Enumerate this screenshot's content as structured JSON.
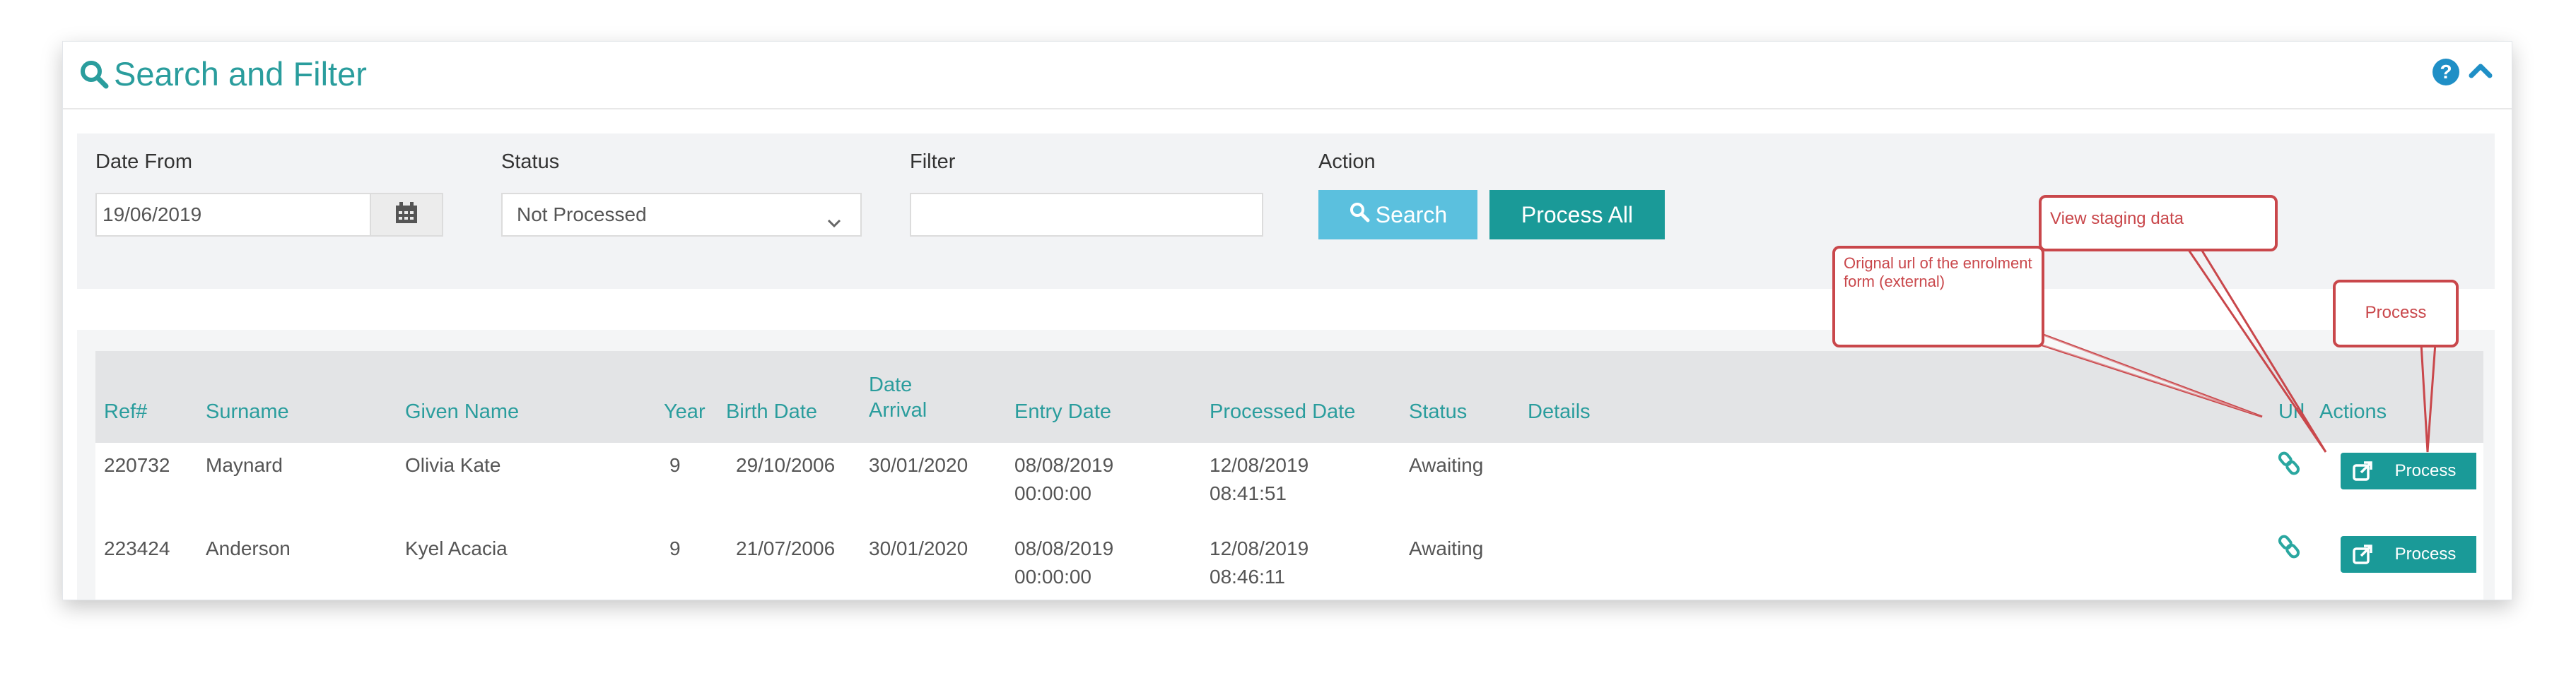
{
  "header": {
    "title": "Search and Filter"
  },
  "filters": {
    "date_from": {
      "label": "Date From",
      "value": "19/06/2019"
    },
    "status": {
      "label": "Status",
      "value": "Not Processed"
    },
    "filter": {
      "label": "Filter",
      "value": ""
    },
    "action": {
      "label": "Action",
      "search_label": "Search",
      "process_all_label": "Process All"
    }
  },
  "table": {
    "columns": {
      "ref": "Ref#",
      "surname": "Surname",
      "given_name": "Given Name",
      "year": "Year",
      "birth_date": "Birth Date",
      "date_arrival_1": "Date",
      "date_arrival_2": "Arrival",
      "entry_date": "Entry Date",
      "processed_date": "Processed Date",
      "status": "Status",
      "details": "Details",
      "url": "Url",
      "actions": "Actions"
    },
    "rows": [
      {
        "ref": "220732",
        "surname": "Maynard",
        "given_name": "Olivia Kate",
        "year": "9",
        "birth_date": "29/10/2006",
        "date_arrival": "30/01/2020",
        "entry_date_1": "08/08/2019",
        "entry_date_2": "00:00:00",
        "processed_date_1": "12/08/2019",
        "processed_date_2": "08:41:51",
        "status": "Awaiting",
        "details": "",
        "process_label": "Process"
      },
      {
        "ref": "223424",
        "surname": "Anderson",
        "given_name": "Kyel Acacia",
        "year": "9",
        "birth_date": "21/07/2006",
        "date_arrival": "30/01/2020",
        "entry_date_1": "08/08/2019",
        "entry_date_2": "00:00:00",
        "processed_date_1": "12/08/2019",
        "processed_date_2": "08:46:11",
        "status": "Awaiting",
        "details": "",
        "process_label": "Process"
      }
    ]
  },
  "annotations": {
    "original_url": "Orignal url of the enrolment form (external)",
    "view_staging": "View staging data",
    "process": "Process"
  },
  "icons": {
    "search": "search-icon",
    "help": "help-icon",
    "collapse": "chevron-up-icon",
    "calendar": "calendar-icon",
    "dropdown": "chevron-down-icon",
    "url": "link-icon",
    "staging": "external-link-icon"
  },
  "colors": {
    "accent": "#2a9d9d",
    "button_teal": "#1a9a98",
    "search_button": "#5bc0de",
    "help": "#1f8fc6",
    "annotation": "#c9474b"
  }
}
